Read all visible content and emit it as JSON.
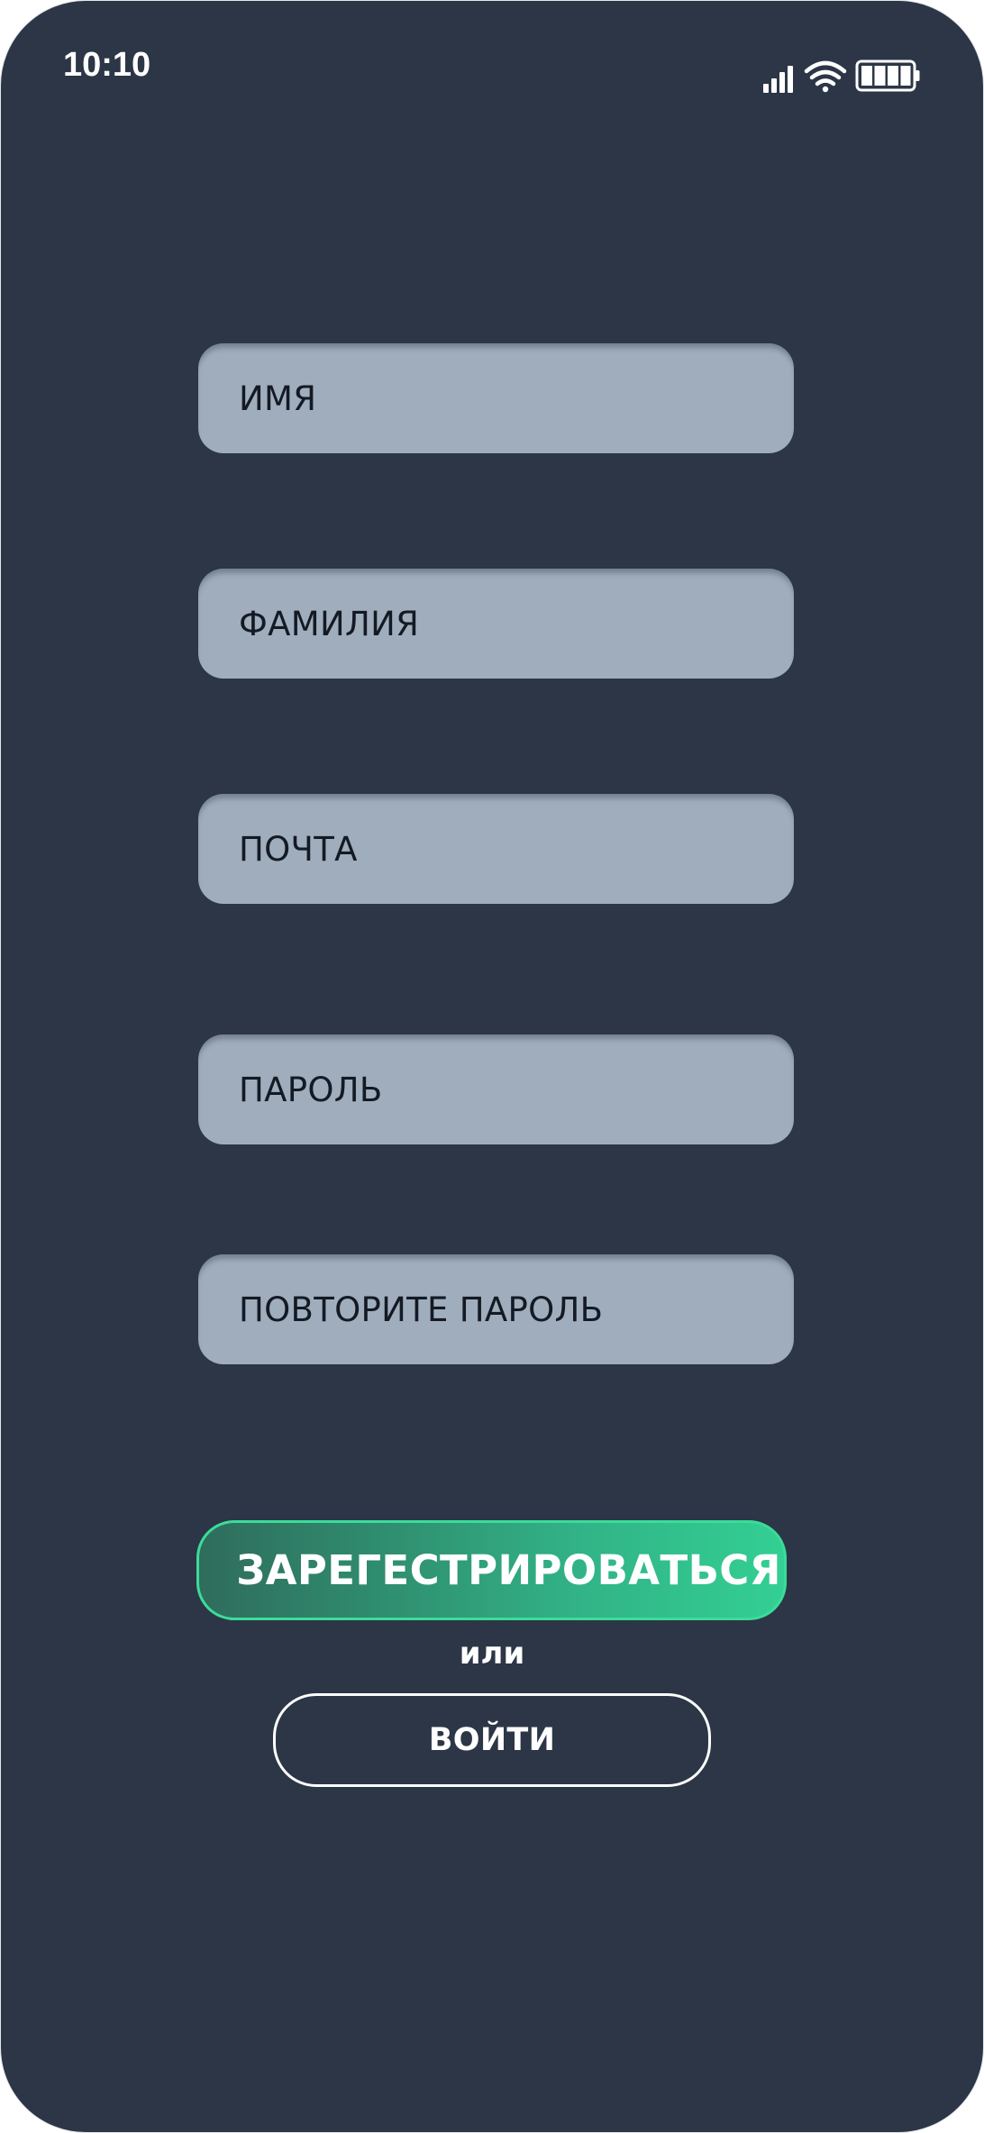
{
  "status_bar": {
    "time": "10:10",
    "icons": [
      "signal-icon",
      "wifi-icon",
      "battery-icon"
    ]
  },
  "form": {
    "fields": [
      {
        "placeholder": "ИМЯ",
        "value": ""
      },
      {
        "placeholder": "ФАМИЛИЯ",
        "value": ""
      },
      {
        "placeholder": "ПОЧТА",
        "value": ""
      },
      {
        "placeholder": "ПАРОЛЬ",
        "value": ""
      },
      {
        "placeholder": "ПОВТОРИТЕ ПАРОЛЬ",
        "value": ""
      }
    ],
    "register_label": "ЗАРЕГЕСТРИРОВАТЬСЯ",
    "or_label": "или",
    "login_label": "ВОЙТИ"
  },
  "colors": {
    "background": "#2c3646",
    "field_fill": "#a0adbc",
    "field_text": "#131a24",
    "accent_start": "#2f6c5c",
    "accent_end": "#33cf93",
    "accent_border": "#3bdc9a",
    "text_light": "#ffffff"
  }
}
